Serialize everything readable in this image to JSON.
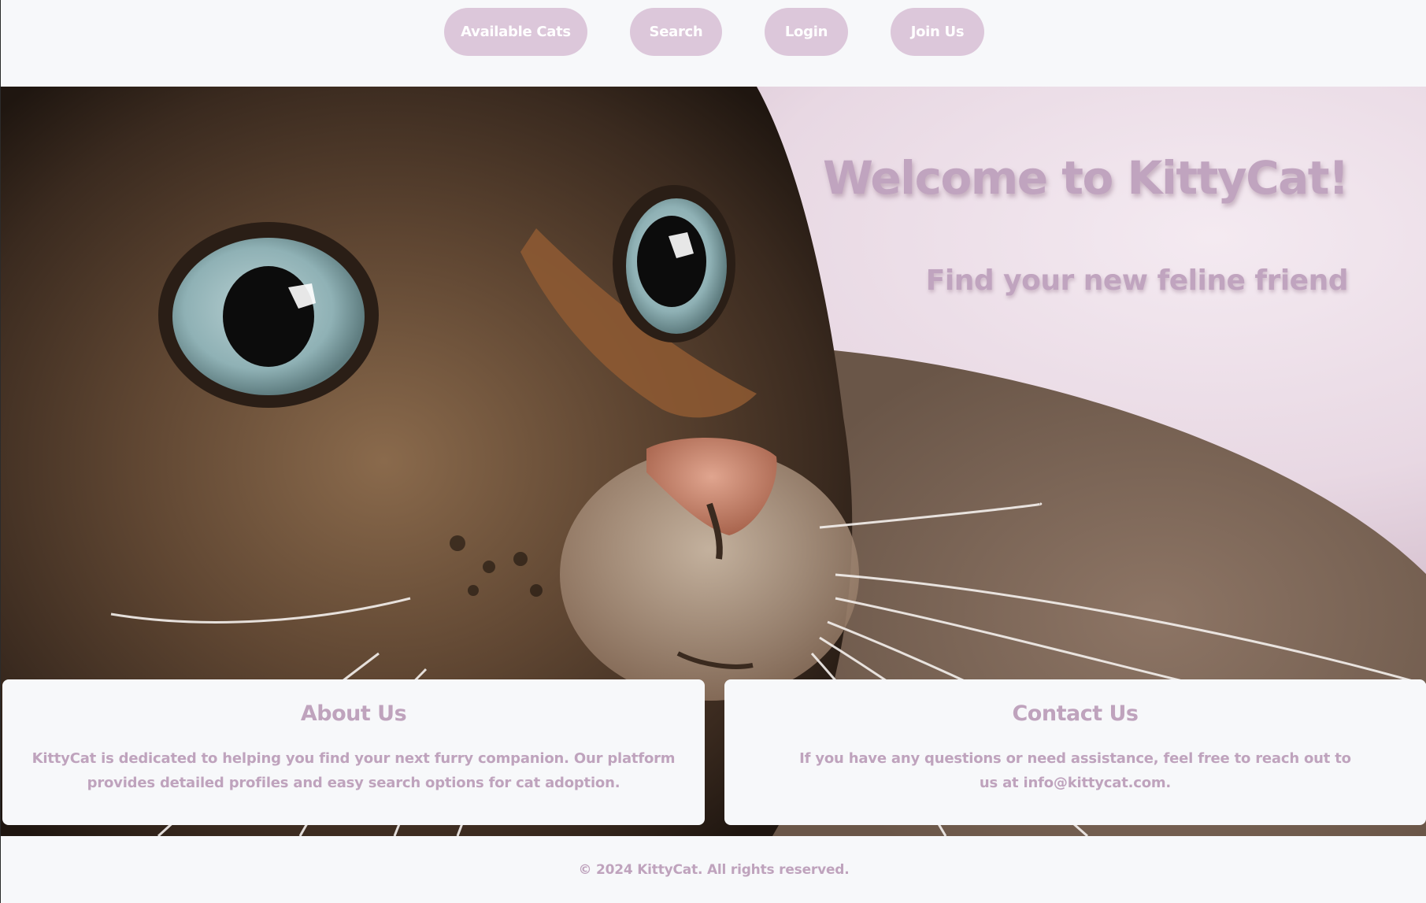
{
  "nav": {
    "items": [
      {
        "label": "Available Cats"
      },
      {
        "label": "Search"
      },
      {
        "label": "Login"
      },
      {
        "label": "Join Us"
      }
    ]
  },
  "hero": {
    "title": "Welcome to KittyCat!",
    "subtitle": "Find your new feline friend",
    "image_icon": "cat-photo"
  },
  "about": {
    "heading": "About Us",
    "text": "KittyCat is dedicated to helping you find your next furry companion. Our platform provides detailed profiles and easy search options for cat adoption."
  },
  "contact": {
    "heading": "Contact Us",
    "text": "If you have any questions or need assistance, feel free to reach out to us at info@kittycat.com."
  },
  "footer": {
    "text": "© 2024 KittyCat. All rights reserved."
  },
  "colors": {
    "accent": "#dcc7da",
    "text_accent": "#c0a4bf",
    "background": "#f7f8fa"
  }
}
